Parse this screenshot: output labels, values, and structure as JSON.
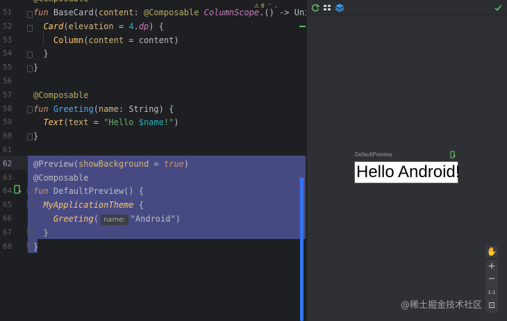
{
  "editor": {
    "top_partial": "@Composable",
    "inspection": {
      "warnings": "⚠ 8",
      "arrows": "⌃ ⌄"
    },
    "lines": [
      {
        "no": "51",
        "parts": [
          [
            "kw",
            "fun"
          ],
          [
            "prm",
            " BaseCard("
          ],
          [
            "named",
            "content"
          ],
          [
            "prm",
            ": "
          ],
          [
            "ann",
            "@Composable"
          ],
          [
            "typi",
            " ColumnScope"
          ],
          [
            "prm",
            ".() -> "
          ],
          [
            "typ",
            "Unit"
          ],
          [
            "prm",
            ") {"
          ]
        ]
      },
      {
        "no": "52",
        "parts": [
          [
            "prm",
            "  "
          ],
          [
            "comp ital",
            "Card"
          ],
          [
            "prm",
            "("
          ],
          [
            "named",
            "elevation"
          ],
          [
            "prm",
            " = "
          ],
          [
            "num",
            "4"
          ],
          [
            "prm",
            "."
          ],
          [
            "typi",
            "dp"
          ],
          [
            "prm",
            ") {"
          ]
        ]
      },
      {
        "no": "53",
        "parts": [
          [
            "prm",
            "    "
          ],
          [
            "comp",
            "Column"
          ],
          [
            "prm",
            "("
          ],
          [
            "named",
            "content"
          ],
          [
            "prm",
            " = "
          ],
          [
            "prm",
            "content"
          ],
          [
            "prm",
            ")"
          ]
        ]
      },
      {
        "no": "54",
        "parts": [
          [
            "prm",
            "  }"
          ]
        ]
      },
      {
        "no": "55",
        "parts": [
          [
            "prm",
            "}"
          ]
        ]
      },
      {
        "no": "56",
        "parts": [
          [
            "prm",
            ""
          ]
        ]
      },
      {
        "no": "57",
        "parts": [
          [
            "ann",
            "@Composable"
          ]
        ]
      },
      {
        "no": "58",
        "parts": [
          [
            "kw",
            "fun"
          ],
          [
            "prm",
            " "
          ],
          [
            "fn",
            "Greeting"
          ],
          [
            "prm",
            "("
          ],
          [
            "named",
            "name"
          ],
          [
            "prm",
            ": "
          ],
          [
            "typ",
            "String"
          ],
          [
            "prm",
            ") {"
          ]
        ]
      },
      {
        "no": "59",
        "parts": [
          [
            "prm",
            "  "
          ],
          [
            "comp ital",
            "Text"
          ],
          [
            "prm",
            "("
          ],
          [
            "named",
            "text"
          ],
          [
            "prm",
            " = "
          ],
          [
            "str",
            "\"Hello "
          ],
          [
            "num",
            "$name"
          ],
          [
            "str",
            "!\""
          ],
          [
            "prm",
            ")"
          ]
        ]
      },
      {
        "no": "60",
        "parts": [
          [
            "prm",
            "}"
          ]
        ]
      },
      {
        "no": "61",
        "parts": [
          [
            "prm",
            ""
          ]
        ]
      },
      {
        "no": "62",
        "parts": [
          [
            "prm",
            "@Preview("
          ],
          [
            "named",
            "showBackground"
          ],
          [
            "prm",
            " = "
          ],
          [
            "kw",
            "true"
          ],
          [
            "prm",
            ")"
          ]
        ]
      },
      {
        "no": "63",
        "parts": [
          [
            "prm",
            "@Composable"
          ]
        ]
      },
      {
        "no": "64",
        "parts": [
          [
            "kw",
            "fun"
          ],
          [
            "prm",
            " DefaultPreview() {"
          ]
        ]
      },
      {
        "no": "65",
        "parts": [
          [
            "prm",
            "  "
          ],
          [
            "comp ital",
            "MyApplicationTheme"
          ],
          [
            "prm",
            " {"
          ]
        ]
      },
      {
        "no": "66",
        "parts": [
          [
            "prm",
            "    "
          ],
          [
            "comp ital",
            "Greeting"
          ],
          [
            "prm",
            "("
          ],
          [
            "hint",
            "name:"
          ],
          [
            "prm",
            "\"Android\")"
          ]
        ]
      },
      {
        "no": "67",
        "parts": [
          [
            "prm",
            "  }"
          ]
        ]
      },
      {
        "no": "68",
        "parts": [
          [
            "prm",
            "}"
          ]
        ]
      }
    ]
  },
  "preview": {
    "label": "DefaultPreview",
    "rendered_text": "Hello Android!",
    "zoom_in": "+",
    "zoom_out": "−",
    "zoom_actual": "1:1",
    "zoom_fit": "⊡",
    "pan": "✋"
  },
  "watermark": "@稀土掘金技术社区",
  "colors": {
    "accent": "#3574f0",
    "selection": "#474a82",
    "editor_bg": "#1e1f22",
    "panel_bg": "#2b2d30"
  }
}
